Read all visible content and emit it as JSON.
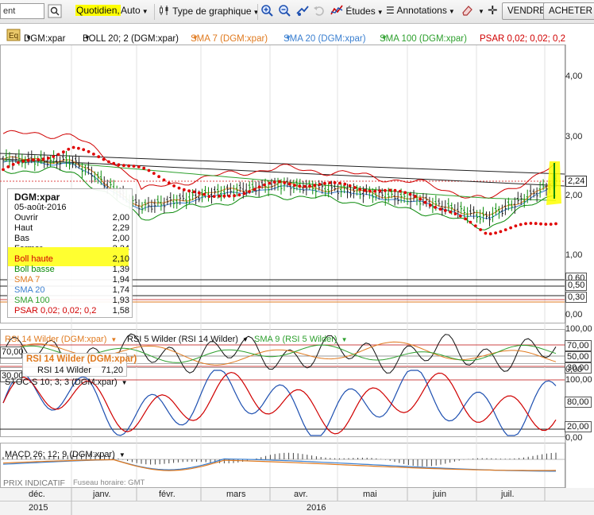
{
  "toolbar": {
    "search_value": "ent",
    "period_label": "Quotidien,",
    "interval_label": "Auto",
    "chart_type_label": "Type de graphique",
    "studies_label": "Études",
    "annotations_label": "Annotations",
    "sell_label": "VENDRE",
    "buy_label": "ACHETER"
  },
  "indicators": {
    "symbol": "DGM:xpar",
    "boll": "BOLL 20; 2 (DGM:xpar)",
    "sma7": "SMA 7 (DGM:xpar)",
    "sma20": "SMA 20 (DGM:xpar)",
    "sma100": "SMA 100 (DGM:xpar)",
    "psar": "PSAR 0,02; 0,02; 0,2"
  },
  "legend": {
    "title": "DGM:xpar",
    "date": "05-août-2016",
    "rows": [
      {
        "label": "Ouvrir",
        "value": "2,00",
        "color": "#111111"
      },
      {
        "label": "Haut",
        "value": "2,29",
        "color": "#111111"
      },
      {
        "label": "Bas",
        "value": "2,00",
        "color": "#111111"
      },
      {
        "label": "Fermer",
        "value": "2,24",
        "color": "#111111"
      },
      {
        "label": "Boll haute",
        "value": "2,10",
        "color": "#d00000"
      },
      {
        "label": "Boll basse",
        "value": "1,39",
        "color": "#0a8a0a"
      },
      {
        "label": "SMA 7",
        "value": "1,94",
        "color": "#e07a1f"
      },
      {
        "label": "SMA 20",
        "value": "1,74",
        "color": "#3a7fd0"
      },
      {
        "label": "SMA 100",
        "value": "1,93",
        "color": "#2ea02e"
      },
      {
        "label": "PSAR 0,02; 0,02; 0,2",
        "value": "1,58",
        "color": "#d00000"
      }
    ]
  },
  "price_axis": {
    "ticks": [
      "4,00",
      "3,00",
      "2,00",
      "1,00",
      "0,00"
    ],
    "current": "2,24",
    "boxes": [
      "0,60",
      "0,50",
      "0,30"
    ]
  },
  "rsi_panel": {
    "title1": "RSI 14 Wilder (DGM:xpar)",
    "title2": "RSI 5 Wilder (RSI 14 Wilder)",
    "title3": "SMA 9 (RSI 5 Wilder)",
    "tooltip_title": "RSI 14 Wilder (DGM:xpar)",
    "tooltip_label": "RSI 14 Wilder",
    "tooltip_value": "71,20",
    "left_box_top": "70,00",
    "left_box_bottom": "30,00",
    "ticks": [
      "100,00",
      "70,00",
      "50,00",
      "30,00",
      "0,00"
    ]
  },
  "stoch_panel": {
    "title": "STOC-S 10; 3; 3 (DGM:xpar)",
    "ticks": [
      "100,00",
      "80,00",
      "20,00",
      "0,00"
    ]
  },
  "macd_panel": {
    "title": "MACD 26; 12; 9 (DGM:xpar)",
    "footer": "PRIX INDICATIF",
    "timezone": "Fuseau horaire: GMT"
  },
  "x_axis": {
    "months": [
      "déc.",
      "janv.",
      "févr.",
      "mars",
      "avr.",
      "mai",
      "juin",
      "juil."
    ],
    "years": [
      "2015",
      "2016"
    ]
  },
  "colors": {
    "candle_up": "#0a8a0a",
    "candle_down": "#222222",
    "boll": "#d00000",
    "sma7": "#e07a1f",
    "sma20": "#3a7fd0",
    "sma100": "#2ea02e",
    "psar": "#e00000",
    "highlight": "#ffff00"
  },
  "chart_data": {
    "type": "line",
    "title": "DGM:xpar",
    "x": [
      "déc. 2015",
      "janv. 2016",
      "févr. 2016",
      "mars 2016",
      "avr. 2016",
      "mai 2016",
      "juin 2016",
      "juil. 2016",
      "05-août-2016"
    ],
    "ylim": [
      0,
      4.5
    ],
    "series": [
      {
        "name": "DGM:xpar",
        "values": [
          2.62,
          2.6,
          1.82,
          2.05,
          2.2,
          2.1,
          1.95,
          1.65,
          2.24
        ]
      },
      {
        "name": "SMA 100 (DGM:xpar)",
        "values": [
          2.6,
          2.55,
          2.45,
          2.35,
          2.25,
          2.15,
          2.05,
          1.97,
          1.93
        ]
      },
      {
        "name": "PSAR 0,02; 0,02; 0,2",
        "values": [
          2.45,
          2.8,
          2.45,
          1.95,
          2.22,
          2.18,
          2.0,
          1.4,
          1.58
        ]
      }
    ]
  }
}
